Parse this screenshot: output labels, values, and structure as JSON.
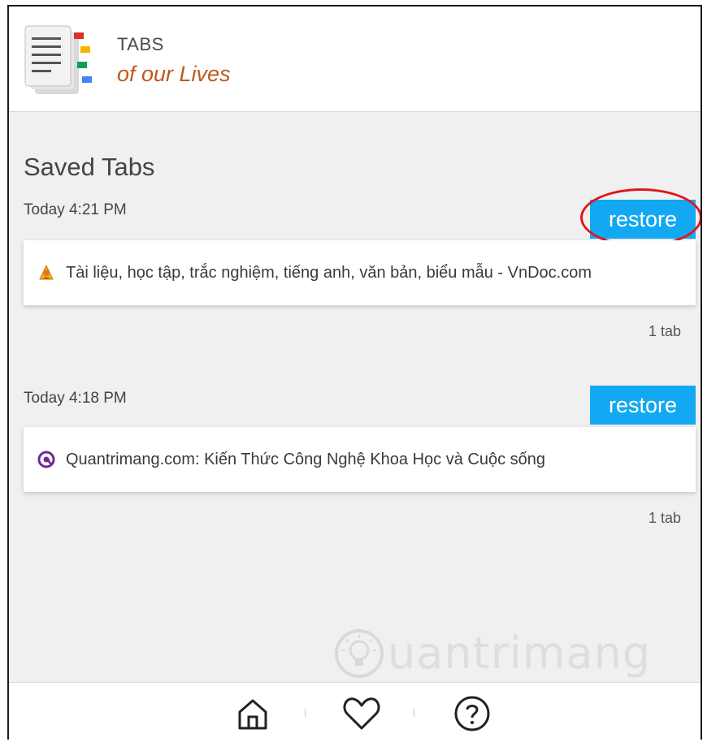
{
  "header": {
    "title": "TABS",
    "subtitle": "of our Lives",
    "logo_icon": "tabs-document-icon"
  },
  "main": {
    "section_title": "Saved Tabs",
    "sessions": [
      {
        "time": "Today 4:21 PM",
        "restore_label": "restore",
        "tabs": [
          {
            "title": "Tài liệu, học tập, trắc nghiệm, tiếng anh, văn bản, biểu mẫu - VnDoc.com",
            "favicon": "vndoc-favicon"
          }
        ],
        "count": "1 tab"
      },
      {
        "time": "Today 4:18 PM",
        "restore_label": "restore",
        "tabs": [
          {
            "title": "Quantrimang.com: Kiến Thức Công Nghệ Khoa Học và Cuộc sống",
            "favicon": "quantrimang-favicon"
          }
        ],
        "count": "1 tab"
      }
    ]
  },
  "footer": {
    "nav": [
      {
        "name": "home",
        "icon": "home-icon"
      },
      {
        "name": "favorites",
        "icon": "heart-icon"
      },
      {
        "name": "help",
        "icon": "help-icon"
      }
    ]
  },
  "watermark": {
    "text": "uantrimang"
  },
  "colors": {
    "accent": "#13a9f2",
    "subtitle": "#c0581c",
    "highlight": "#e0161b",
    "background": "#f0f0f0"
  }
}
